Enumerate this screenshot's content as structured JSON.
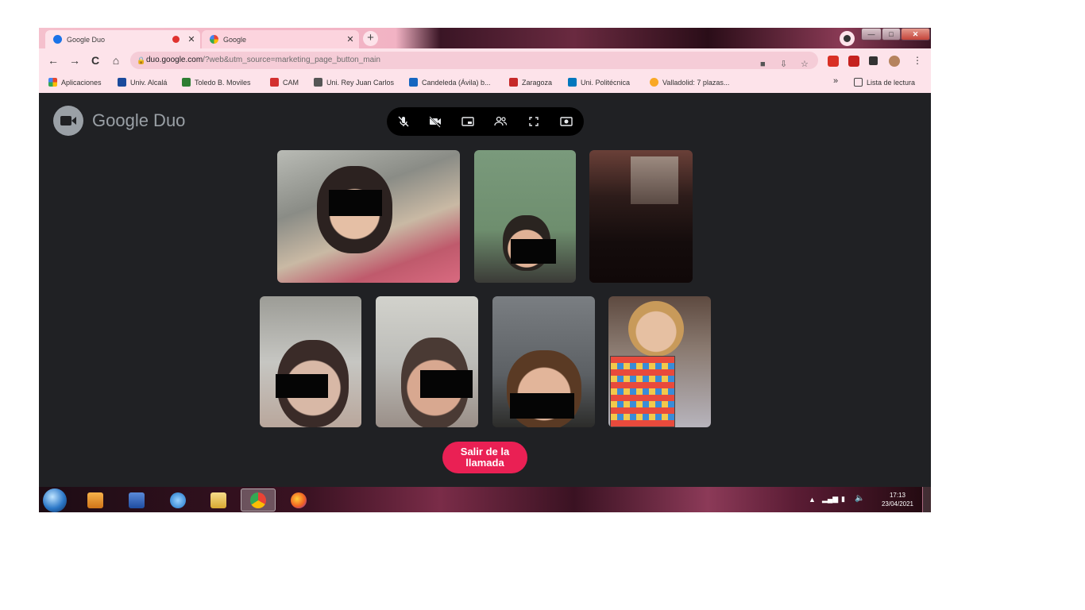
{
  "browser": {
    "tabs": [
      {
        "title": "Google Duo",
        "active": true,
        "recording": true
      },
      {
        "title": "Google",
        "active": false,
        "recording": false
      }
    ],
    "new_tab": "+",
    "window_buttons": {
      "minimize": "—",
      "maximize": "□",
      "close": "✕"
    },
    "nav": {
      "back": "←",
      "forward": "→",
      "reload": "C",
      "home": "⌂"
    },
    "address": {
      "host": "duo.google.com",
      "path": "/?web&utm_source=marketing_page_button_main"
    },
    "bookmarks": [
      {
        "label": "Aplicaciones",
        "color": "#e8452c"
      },
      {
        "label": "Univ. Alcalá",
        "color": "#1a4a9c"
      },
      {
        "label": "Toledo B. Moviles",
        "color": "#2e7d32"
      },
      {
        "label": "CAM",
        "color": "#d32f2f"
      },
      {
        "label": "Uni. Rey Juan Carlos",
        "color": "#555555"
      },
      {
        "label": "Candeleda (Ávila) b...",
        "color": "#1565c0"
      },
      {
        "label": "Zaragoza",
        "color": "#c62828"
      },
      {
        "label": "Uni. Politécnica",
        "color": "#0277bd"
      },
      {
        "label": "Valladolid: 7 plazas...",
        "color": "#f9a825"
      }
    ],
    "bookmarks_more": "»",
    "reading_list": "Lista de lectura"
  },
  "duo": {
    "brand": "Google Duo",
    "controls": [
      "mic-off",
      "camera-off",
      "picture-in-picture",
      "participants",
      "fullscreen",
      "screen-share"
    ],
    "exit_label": "Salir de la llamada",
    "exit_color": "#ea2054"
  },
  "taskbar": {
    "clock_time": "17:13",
    "clock_date": "23/04/2021"
  }
}
